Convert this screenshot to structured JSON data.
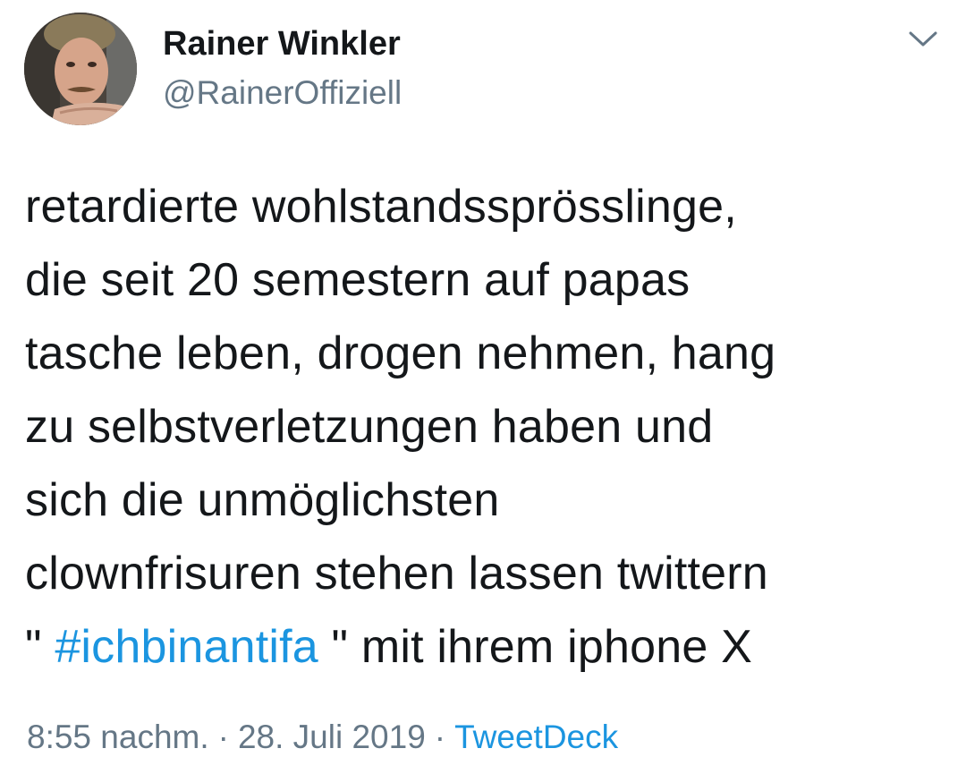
{
  "author": {
    "display_name": "Rainer Winkler",
    "handle": "@RainerOffiziell"
  },
  "tweet": {
    "lines": [
      "retardierte wohlstandssprösslinge,",
      "die seit 20 semestern auf papas",
      "tasche leben, drogen nehmen, hang",
      "zu selbstverletzungen haben und",
      "sich die unmöglichsten",
      "clownfrisuren stehen lassen twittern"
    ],
    "last_line_prefix": "\" ",
    "hashtag": "#ichbinantifa",
    "last_line_suffix": " \" mit ihrem iphone X"
  },
  "meta": {
    "time": "8:55 nachm.",
    "separator": "·",
    "date": "28. Juli 2019",
    "source": "TweetDeck"
  },
  "icons": {
    "menu": "chevron-down-icon"
  },
  "colors": {
    "text": "#14171a",
    "secondary": "#657786",
    "link": "#1b95e0"
  }
}
